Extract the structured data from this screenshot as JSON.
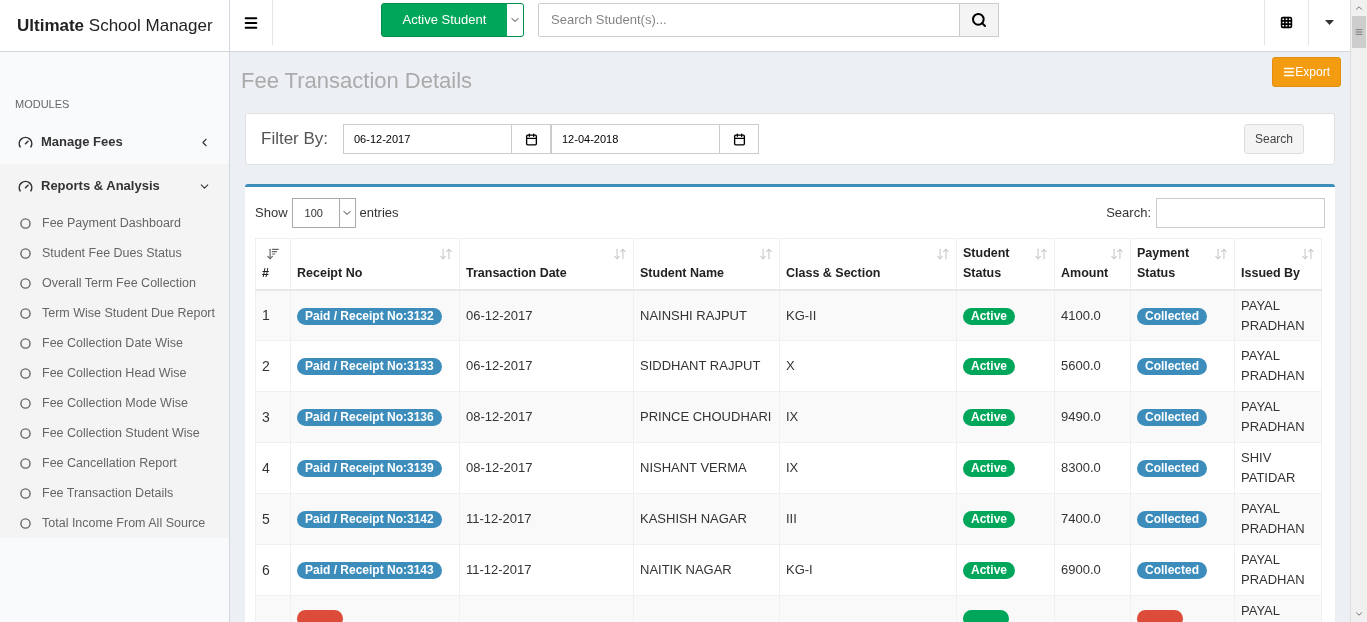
{
  "brand": {
    "bold": "Ultimate",
    "rest": "School Manager"
  },
  "topbar": {
    "dropdown": "Active Student",
    "search": {
      "placeholder": "Search Student(s)..."
    }
  },
  "sidebar": {
    "heading": "MODULES",
    "groups": [
      {
        "label": "Manage Fees",
        "expanded": false
      },
      {
        "label": "Reports & Analysis",
        "expanded": true,
        "children": [
          {
            "label": "Fee Payment Dashboard"
          },
          {
            "label": "Student Fee Dues Status"
          },
          {
            "label": "Overall Term Fee Collection"
          },
          {
            "label": "Term Wise Student Due Report"
          },
          {
            "label": "Fee Collection Date Wise"
          },
          {
            "label": "Fee Collection Head Wise"
          },
          {
            "label": "Fee Collection Mode Wise"
          },
          {
            "label": "Fee Collection Student Wise"
          },
          {
            "label": "Fee Cancellation Report"
          },
          {
            "label": "Fee Transaction Details"
          },
          {
            "label": "Total Income From All Source"
          }
        ]
      }
    ]
  },
  "page": {
    "title": "Fee Transaction Details",
    "export": "Export"
  },
  "filter": {
    "label": "Filter By:",
    "from": "06-12-2017",
    "to": "12-04-2018",
    "button": "Search"
  },
  "table_controls": {
    "show": "Show",
    "entries_value": "100",
    "entries": "entries",
    "search_label": "Search:"
  },
  "table": {
    "columns": [
      {
        "label": "#",
        "sorted": true
      },
      {
        "label": "Receipt No",
        "sorted": false
      },
      {
        "label": "Transaction Date",
        "sorted": false
      },
      {
        "label": "Student Name",
        "sorted": false
      },
      {
        "label": "Class & Section",
        "sorted": false
      },
      {
        "label": "Student Status",
        "sorted": false
      },
      {
        "label": "Amount",
        "sorted": false
      },
      {
        "label": "Payment Status",
        "sorted": false
      },
      {
        "label": "Issued By",
        "sorted": false
      }
    ],
    "rows": [
      {
        "num": "1",
        "receipt": {
          "kind": "paid",
          "text": "Paid / Receipt No:3132"
        },
        "date": "06-12-2017",
        "name": "NAINSHI RAJPUT",
        "class": "KG-II",
        "student_status": {
          "kind": "active",
          "text": "Active"
        },
        "amount": "4100.0",
        "payment_status": {
          "kind": "collected",
          "text": "Collected"
        },
        "issued_by": "PAYAL PRADHAN"
      },
      {
        "num": "2",
        "receipt": {
          "kind": "paid",
          "text": "Paid / Receipt No:3133"
        },
        "date": "06-12-2017",
        "name": "SIDDHANT RAJPUT",
        "class": "X",
        "student_status": {
          "kind": "active",
          "text": "Active"
        },
        "amount": "5600.0",
        "payment_status": {
          "kind": "collected",
          "text": "Collected"
        },
        "issued_by": "PAYAL PRADHAN"
      },
      {
        "num": "3",
        "receipt": {
          "kind": "paid",
          "text": "Paid / Receipt No:3136"
        },
        "date": "08-12-2017",
        "name": "PRINCE CHOUDHARI",
        "class": "IX",
        "student_status": {
          "kind": "active",
          "text": "Active"
        },
        "amount": "9490.0",
        "payment_status": {
          "kind": "collected",
          "text": "Collected"
        },
        "issued_by": "PAYAL PRADHAN"
      },
      {
        "num": "4",
        "receipt": {
          "kind": "paid",
          "text": "Paid / Receipt No:3139"
        },
        "date": "08-12-2017",
        "name": "NISHANT VERMA",
        "class": "IX",
        "student_status": {
          "kind": "active",
          "text": "Active"
        },
        "amount": "8300.0",
        "payment_status": {
          "kind": "collected",
          "text": "Collected"
        },
        "issued_by": "SHIV PATIDAR"
      },
      {
        "num": "5",
        "receipt": {
          "kind": "paid",
          "text": "Paid / Receipt No:3142"
        },
        "date": "11-12-2017",
        "name": "KASHISH NAGAR",
        "class": "III",
        "student_status": {
          "kind": "active",
          "text": "Active"
        },
        "amount": "7400.0",
        "payment_status": {
          "kind": "collected",
          "text": "Collected"
        },
        "issued_by": "PAYAL PRADHAN"
      },
      {
        "num": "6",
        "receipt": {
          "kind": "paid",
          "text": "Paid / Receipt No:3143"
        },
        "date": "11-12-2017",
        "name": "NAITIK NAGAR",
        "class": "KG-I",
        "student_status": {
          "kind": "active",
          "text": "Active"
        },
        "amount": "6900.0",
        "payment_status": {
          "kind": "collected",
          "text": "Collected"
        },
        "issued_by": "PAYAL PRADHAN"
      },
      {
        "receipt": {
          "kind": "cancelled"
        },
        "student_status": {
          "kind": "active"
        },
        "payment_status": {
          "kind": "cancelled"
        },
        "issued_by": "PAYAL"
      }
    ]
  }
}
